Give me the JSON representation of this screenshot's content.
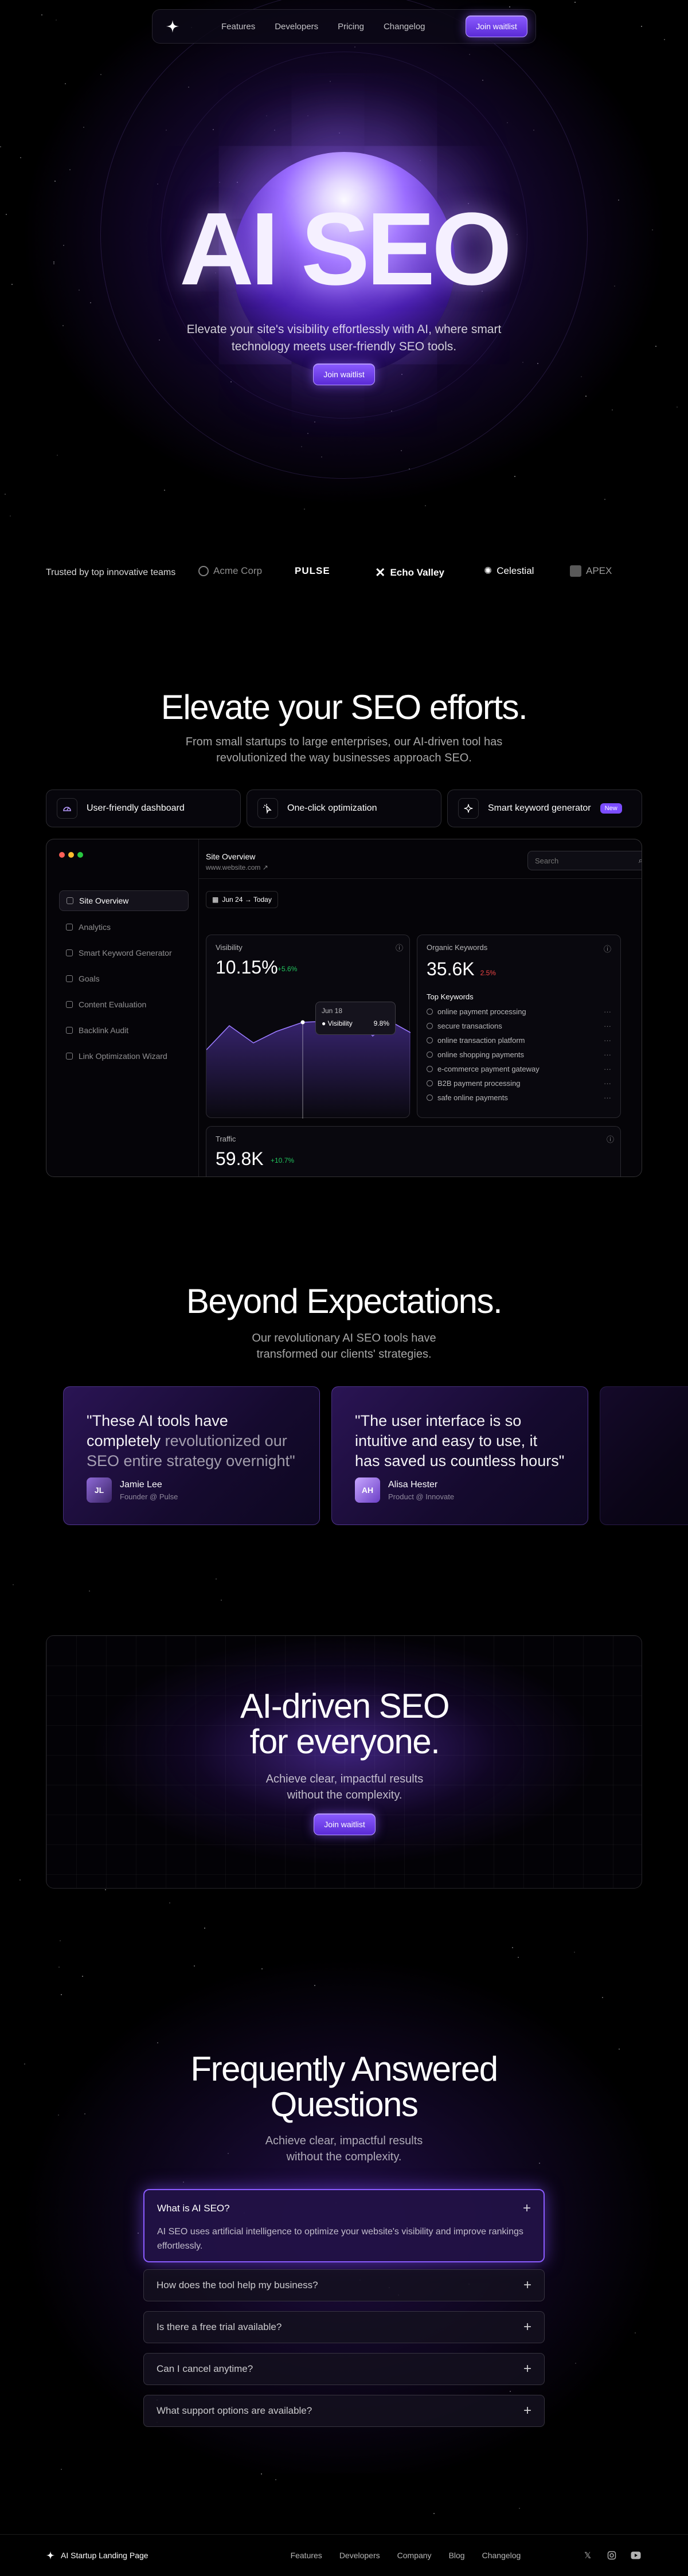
{
  "nav": {
    "links": [
      "Features",
      "Developers",
      "Pricing",
      "Changelog"
    ],
    "cta": "Join waitlist"
  },
  "hero": {
    "title": "AI SEO",
    "subtitle": "Elevate your site's visibility effortlessly with AI, where smart technology meets user-friendly SEO tools.",
    "cta": "Join waitlist"
  },
  "trusted": {
    "label": "Trusted by top innovative teams",
    "logos": [
      "Acme Corp",
      "PULSE",
      "Echo Valley",
      "Celestial",
      "APEX"
    ]
  },
  "features": {
    "title": "Elevate your SEO efforts.",
    "subtitle": "From small startups to large enterprises, our AI-driven tool has revolutionized the way businesses approach SEO.",
    "tabs": [
      {
        "label": "User-friendly dashboard",
        "icon": "gauge-icon"
      },
      {
        "label": "One-click optimization",
        "icon": "click-icon"
      },
      {
        "label": "Smart keyword generator",
        "icon": "sparkle-icon",
        "badge": "New"
      }
    ]
  },
  "dashboard": {
    "sidebar": [
      "Site Overview",
      "Analytics",
      "Smart Keyword Generator",
      "Goals",
      "Content Evaluation",
      "Backlink Audit",
      "Link Optimization Wizard"
    ],
    "header_title": "Site Overview",
    "header_url": "www.website.com",
    "search_placeholder": "Search",
    "date_range": "Jun 24 → Today",
    "visibility": {
      "label": "Visibility",
      "value": "10.15%",
      "change": "+5.6%",
      "tooltip_date": "Jun 18",
      "tooltip_label": "Visibility",
      "tooltip_value": "9.8%"
    },
    "organic": {
      "label": "Organic Keywords",
      "value": "35.6K",
      "change": "2.5%"
    },
    "top_keywords_title": "Top Keywords",
    "keywords": [
      "online payment processing",
      "secure transactions",
      "online transaction platform",
      "online shopping payments",
      "e-commerce payment gateway",
      "B2B payment processing",
      "safe online payments"
    ],
    "traffic": {
      "label": "Traffic",
      "value": "59.8K",
      "change": "+10.7%"
    },
    "colors": {
      "positive": "#22c55e",
      "negative": "#ef4444",
      "accent": "#8a5bff"
    }
  },
  "testimonials": {
    "title": "Beyond Expectations.",
    "subtitle": "Our revolutionary AI SEO tools have transformed our clients' strategies.",
    "items": [
      {
        "quote_bright": "\"These AI tools have completely",
        "quote_dim": "revolutionized our SEO entire strategy overnight\"",
        "name": "Jamie Lee",
        "role": "Founder @ Pulse"
      },
      {
        "quote_bright": "\"The user interface is so intuitive and easy to use, it has saved us countless hours\"",
        "quote_dim": "",
        "name": "Alisa Hester",
        "role": "Product @ Innovate"
      }
    ]
  },
  "cta": {
    "title_line1": "AI-driven SEO",
    "title_line2": "for everyone.",
    "subtitle": "Achieve clear, impactful results without the complexity.",
    "button": "Join waitlist"
  },
  "faq": {
    "title_line1": "Frequently Answered",
    "title_line2": "Questions",
    "subtitle": "Achieve clear, impactful results without the complexity.",
    "open_question": "What is AI SEO?",
    "open_answer": "AI SEO uses artificial intelligence to optimize your website's visibility and improve rankings effortlessly.",
    "questions": [
      "How does the tool help my business?",
      "Is there a free trial available?",
      "Can I cancel anytime?",
      "What support options are available?"
    ]
  },
  "footer": {
    "brand": "AI Startup Landing Page",
    "links": [
      "Features",
      "Developers",
      "Company",
      "Blog",
      "Changelog"
    ],
    "socials": [
      "x-icon",
      "instagram-icon",
      "youtube-icon"
    ]
  }
}
